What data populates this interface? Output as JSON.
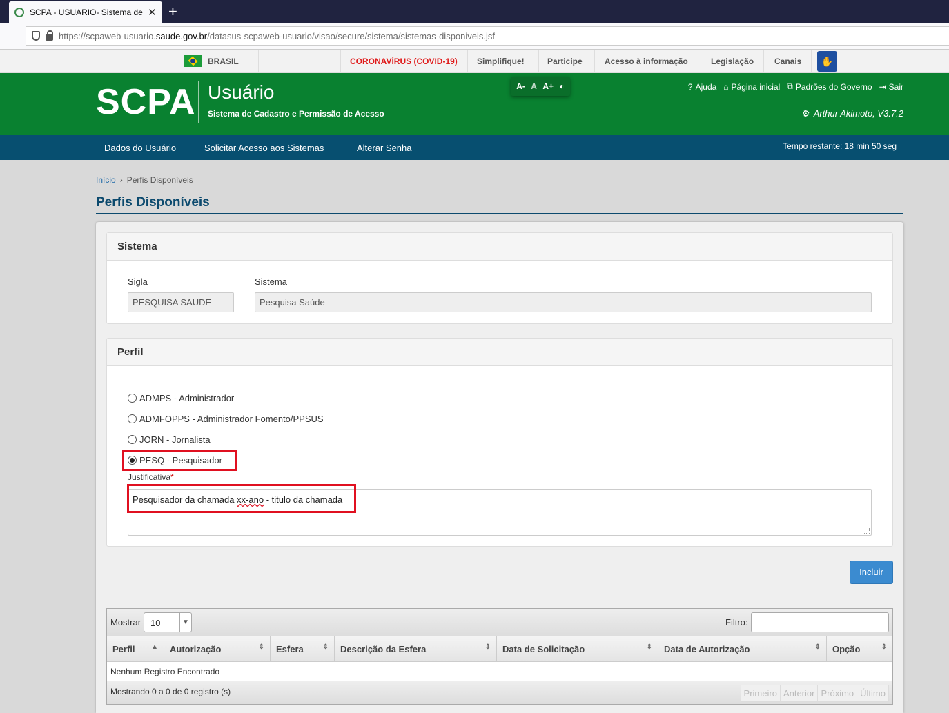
{
  "browser": {
    "tab_title": "SCPA - USUARIO- Sistema de C",
    "url_prefix": "https://scpaweb-usuario.",
    "url_domain": "saude.gov.br",
    "url_path": "/datasus-scpaweb-usuario/visao/secure/sistema/sistemas-disponiveis.jsf"
  },
  "govbar": {
    "country": "BRASIL",
    "links": [
      "CORONAVÍRUS (COVID-19)",
      "Simplifique!",
      "Participe",
      "Acesso à informação",
      "Legislação",
      "Canais"
    ]
  },
  "header": {
    "logo": "SCPA",
    "subtitle": "Usuário",
    "description": "Sistema de Cadastro e Permissão de Acesso",
    "font_controls": [
      "A-",
      "A",
      "A+"
    ],
    "links": [
      "Ajuda",
      "Página inicial",
      "Padrões do Governo",
      "Sair"
    ],
    "user": "Arthur Akimoto, V3.7.2"
  },
  "nav": {
    "items": [
      "Dados do Usuário",
      "Solicitar Acesso aos Sistemas",
      "Alterar Senha"
    ],
    "timer": "Tempo restante: 18 min 50 seg"
  },
  "breadcrumb": {
    "home": "Início",
    "current": "Perfis Disponíveis"
  },
  "page_title": "Perfis Disponíveis",
  "sistema": {
    "heading": "Sistema",
    "sigla_label": "Sigla",
    "sigla_value": "PESQUISA SAUDE",
    "sistema_label": "Sistema",
    "sistema_value": "Pesquisa Saúde"
  },
  "perfil": {
    "heading": "Perfil",
    "options": [
      {
        "label": "ADMPS - Administrador",
        "selected": false
      },
      {
        "label": "ADMFOPPS - Administrador Fomento/PPSUS",
        "selected": false
      },
      {
        "label": "JORN - Jornalista",
        "selected": false
      },
      {
        "label": "PESQ - Pesquisador",
        "selected": true
      }
    ],
    "justificativa_label": "Justificativa",
    "required_mark": "*",
    "justificativa_before": "Pesquisador da chamada ",
    "justificativa_misspelled": "xx-ano",
    "justificativa_after": " - titulo da chamada"
  },
  "incluir_button": "Incluir",
  "table": {
    "show_label": "Mostrar",
    "page_size": "10",
    "filter_label": "Filtro:",
    "columns": [
      "Perfil",
      "Autorização",
      "Esfera",
      "Descrição da Esfera",
      "Data de Solicitação",
      "Data de Autorização",
      "Opção"
    ],
    "empty_message": "Nenhum Registro Encontrado",
    "info": "Mostrando 0 a 0 de 0 registro (s)",
    "pager": [
      "Primeiro",
      "Anterior",
      "Próximo",
      "Último"
    ]
  },
  "colors": {
    "header_green": "#098130",
    "nav_blue": "#074f70",
    "title_blue": "#0c4a6e",
    "button_blue": "#3b8bd0",
    "highlight_red": "#e01020"
  }
}
